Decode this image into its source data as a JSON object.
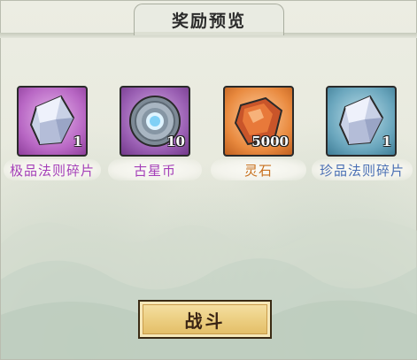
{
  "title": "奖励预览",
  "rewards": [
    {
      "name": "极品法则碎片",
      "count": "1",
      "icon": "purple-crystal-shard-icon",
      "frame_color": "#b867c4",
      "label_color": "#a43fb8"
    },
    {
      "name": "古星币",
      "count": "10",
      "icon": "star-coin-icon",
      "frame_color": "#9a5fb3",
      "label_color": "#a43fb8"
    },
    {
      "name": "灵石",
      "count": "5000",
      "icon": "spirit-stone-icon",
      "frame_color": "#e98a3f",
      "label_color": "#c8701e"
    },
    {
      "name": "珍品法则碎片",
      "count": "1",
      "icon": "blue-crystal-shard-icon",
      "frame_color": "#6aa6bd",
      "label_color": "#4a6fb4"
    }
  ],
  "fight_button": {
    "label": "战斗"
  }
}
